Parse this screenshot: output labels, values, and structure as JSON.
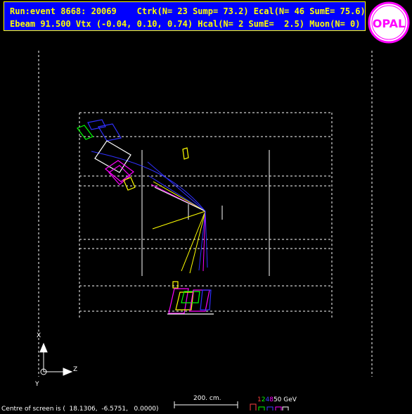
{
  "header": {
    "line1": "Run:event 8668: 20069    Ctrk(N= 23 Sump= 73.2) Ecal(N= 46 SumE= 75.6)",
    "line2": "Ebeam 91.500 Vtx (-0.04, 0.10, 0.74) Hcal(N= 2 SumE=  2.5) Muon(N= 0)"
  },
  "logo": {
    "text": "OPAL",
    "ring_color": "#ff00ff",
    "fill_color": "#ffffff"
  },
  "axes": {
    "x_label": "X",
    "y_label": "Y",
    "z_label": "Z"
  },
  "scale": {
    "label": "200. cm."
  },
  "footer": {
    "centre_text": "Centre of screen is (  18.1306,  -6.5751,   0.0000)"
  },
  "energy_legend": {
    "keys": [
      {
        "text": "1",
        "color": "#ff4040"
      },
      {
        "text": "2",
        "color": "#00ff00"
      },
      {
        "text": "4",
        "color": "#4040ff"
      },
      {
        "text": "8",
        "color": "#ff00ff"
      },
      {
        "text": "50 GeV",
        "color": "#ffffff"
      }
    ]
  }
}
